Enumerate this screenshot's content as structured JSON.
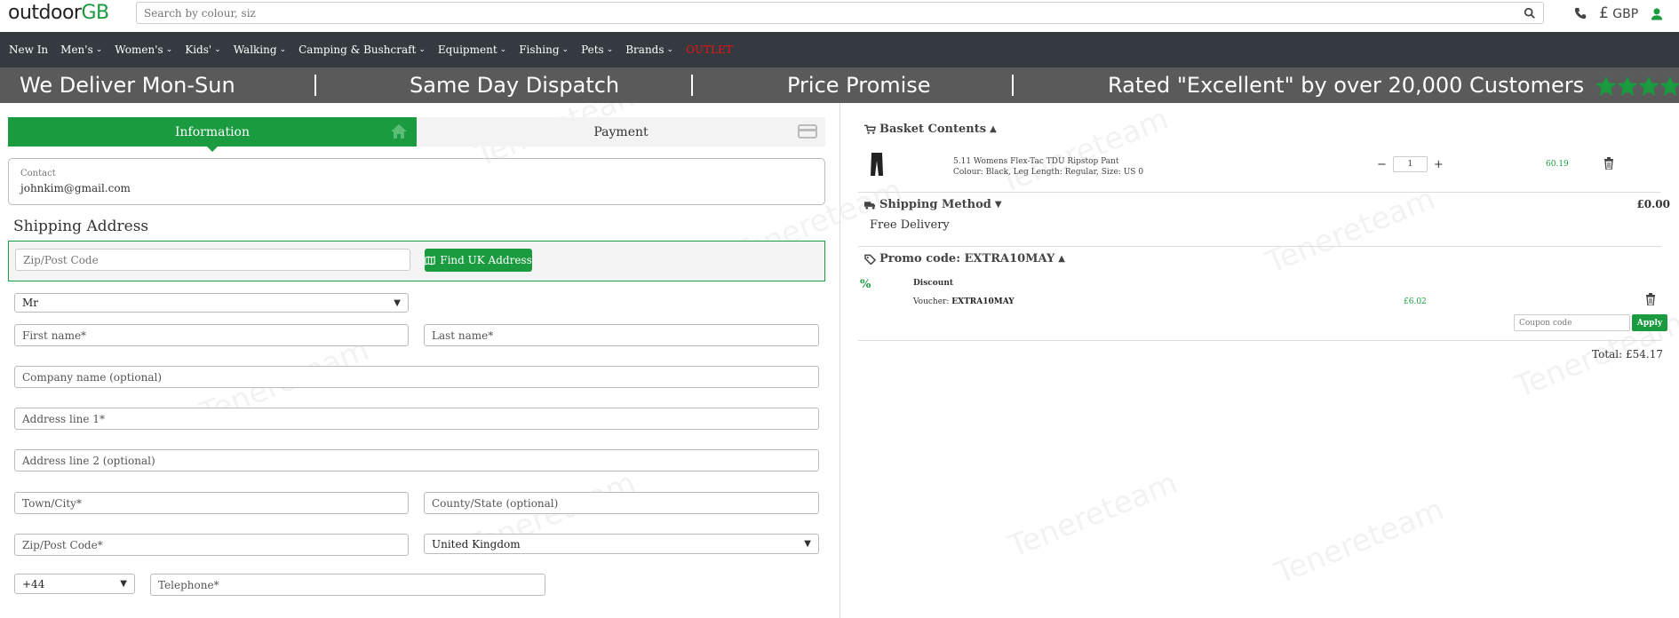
{
  "header": {
    "logo_text": "outdoor",
    "logo_accent": "GB",
    "search_placeholder": "Search by colour, siz",
    "currency_symbol": "£",
    "currency_code": "GBP"
  },
  "nav": {
    "items": [
      {
        "label": "New In",
        "has_menu": false
      },
      {
        "label": "Men's",
        "has_menu": true
      },
      {
        "label": "Women's",
        "has_menu": true
      },
      {
        "label": "Kids'",
        "has_menu": true
      },
      {
        "label": "Walking",
        "has_menu": true
      },
      {
        "label": "Camping & Bushcraft",
        "has_menu": true
      },
      {
        "label": "Equipment",
        "has_menu": true
      },
      {
        "label": "Fishing",
        "has_menu": true
      },
      {
        "label": "Pets",
        "has_menu": true
      },
      {
        "label": "Brands",
        "has_menu": true
      },
      {
        "label": "OUTLET",
        "has_menu": false
      }
    ]
  },
  "promo_bar": {
    "delivery": "We Deliver Mon-Sun",
    "dispatch": "Same Day Dispatch",
    "price": "Price Promise",
    "rated": "Rated \"Excellent\" by over 20,000 Customers",
    "rating_stars": 4.5
  },
  "checkout": {
    "step_information": "Information",
    "step_payment": "Payment",
    "contact_label": "Contact",
    "contact_value": "johnkim@gmail.com",
    "shipping_title": "Shipping Address",
    "zip_lookup_placeholder": "Zip/Post Code",
    "find_address_label": "Find UK Address",
    "title_value": "Mr",
    "first_name_placeholder": "First name*",
    "last_name_placeholder": "Last name*",
    "company_placeholder": "Company name (optional)",
    "address1_placeholder": "Address line 1*",
    "address2_placeholder": "Address line 2 (optional)",
    "town_placeholder": "Town/City*",
    "county_placeholder": "County/State (optional)",
    "zip_placeholder": "Zip/Post Code*",
    "country_value": "United Kingdom",
    "dial_code_value": "+44",
    "telephone_placeholder": "Telephone*"
  },
  "basket": {
    "title": "Basket Contents",
    "product_name": "5.11 Womens Flex-Tac TDU Ripstop Pant",
    "product_options": "Colour: Black, Leg Length: Regular, Size: US 0",
    "minus": "−",
    "quantity": "1",
    "plus": "+",
    "product_price": "60.19",
    "shipping_title": "Shipping Method",
    "shipping_amount": "£0.00",
    "shipping_option": "Free Delivery",
    "promo_title": "Promo code: EXTRA10MAY",
    "discount_symbol": "%",
    "discount_title": "Discount",
    "voucher_label": "Voucher:",
    "voucher_code": "EXTRA10MAY",
    "discount_amount": "£6.02",
    "coupon_placeholder": "Coupon code",
    "apply_label": "Apply",
    "total": "Total: £54.17"
  },
  "watermark": "Tenereteam",
  "colors": {
    "brand_green": "#1a9b3f",
    "nav_bg": "#343a40",
    "promo_bg": "#5a5a5a",
    "outlet_red": "#e11111"
  }
}
